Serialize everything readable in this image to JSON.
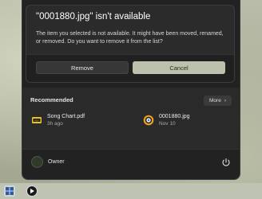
{
  "dialog": {
    "title": "\"0001880.jpg\" isn't available",
    "message": "The item you selected is not available. It might have been moved, renamed, or removed. Do you want to remove it from the list?",
    "remove_label": "Remove",
    "cancel_label": "Cancel"
  },
  "start_menu": {
    "recommended_heading": "Recommended",
    "more_label": "More",
    "items": [
      {
        "name": "Song Chart.pdf",
        "time": "3h ago",
        "icon": "pdf-icon"
      },
      {
        "name": "0001880.jpg",
        "time": "Nov 10",
        "icon": "image-viewer-icon"
      }
    ],
    "user_name": "Owner"
  },
  "colors": {
    "accent_button": "#bcc1ad",
    "panel": "#2a2a2a",
    "dialog": "#2b2b2b"
  }
}
